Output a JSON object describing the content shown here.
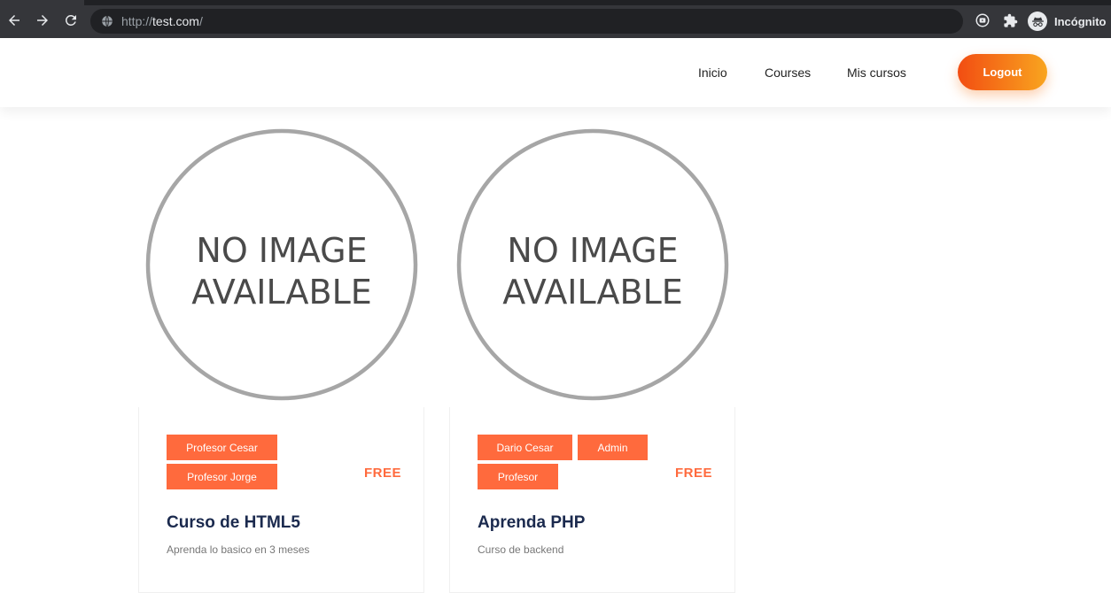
{
  "browser": {
    "url_scheme": "http://",
    "url_host": "test.com",
    "url_path": "/",
    "incognito_label": "Incógnito"
  },
  "header": {
    "nav": [
      "Inicio",
      "Courses",
      "Mis cursos"
    ],
    "logout_label": "Logout",
    "logout_gradient": [
      "#f24d12",
      "#f9a51f"
    ]
  },
  "courses": [
    {
      "image_text": [
        "NO IMAGE",
        "AVAILABLE"
      ],
      "teachers": [
        "Profesor Cesar",
        "Profesor Jorge"
      ],
      "price": "FREE",
      "title": "Curso de HTML5",
      "description": "Aprenda lo basico en 3 meses"
    },
    {
      "image_text": [
        "NO IMAGE",
        "AVAILABLE"
      ],
      "teachers": [
        "Dario Cesar",
        "Admin",
        "Profesor"
      ],
      "price": "FREE",
      "title": "Aprenda PHP",
      "description": "Curso de backend"
    }
  ],
  "colors": {
    "accent": "#ff6a3d",
    "title": "#1b2a4e",
    "placeholder_ring": "#a6a6a6"
  }
}
